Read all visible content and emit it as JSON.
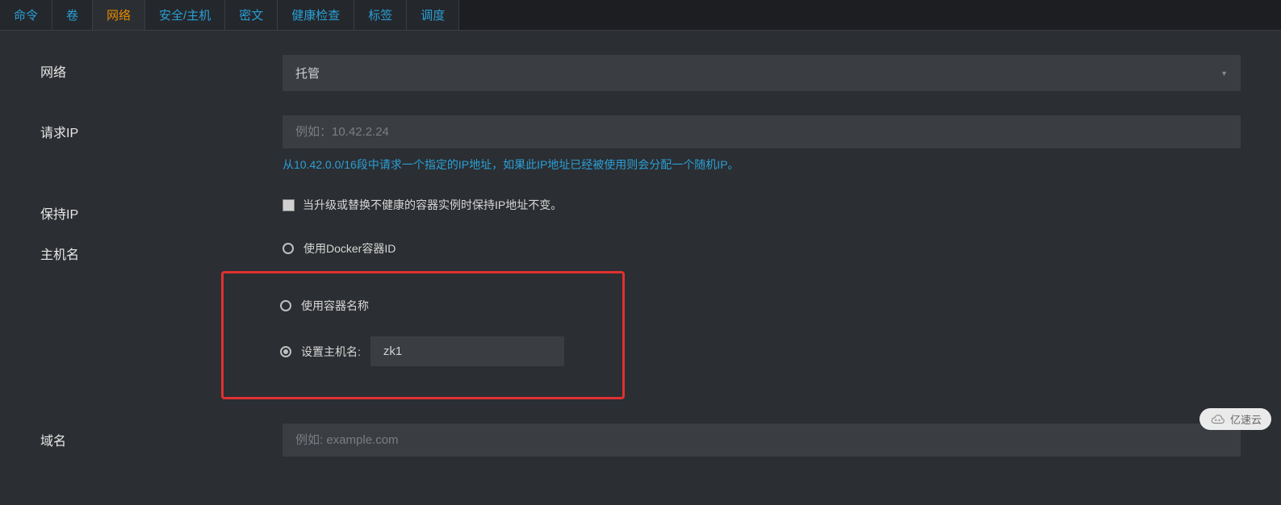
{
  "tabs": [
    {
      "label": "命令"
    },
    {
      "label": "卷"
    },
    {
      "label": "网络"
    },
    {
      "label": "安全/主机"
    },
    {
      "label": "密文"
    },
    {
      "label": "健康检查"
    },
    {
      "label": "标签"
    },
    {
      "label": "调度"
    }
  ],
  "activeTabIndex": 2,
  "network": {
    "label": "网络",
    "value": "托管"
  },
  "requestIp": {
    "label": "请求IP",
    "placeholder": "例如：10.42.2.24",
    "help": "从10.42.0.0/16段中请求一个指定的IP地址，如果此IP地址已经被使用则会分配一个随机IP。"
  },
  "keepIp": {
    "label": "保持IP",
    "checkboxLabel": "当升级或替换不健康的容器实例时保持IP地址不变。"
  },
  "hostname": {
    "label": "主机名",
    "options": [
      {
        "label": "使用Docker容器ID"
      },
      {
        "label": "使用容器名称"
      },
      {
        "label": "设置主机名:"
      }
    ],
    "selectedIndex": 2,
    "customValue": "zk1"
  },
  "domain": {
    "label": "域名",
    "placeholder": "例如: example.com"
  },
  "footerBadge": "亿速云"
}
